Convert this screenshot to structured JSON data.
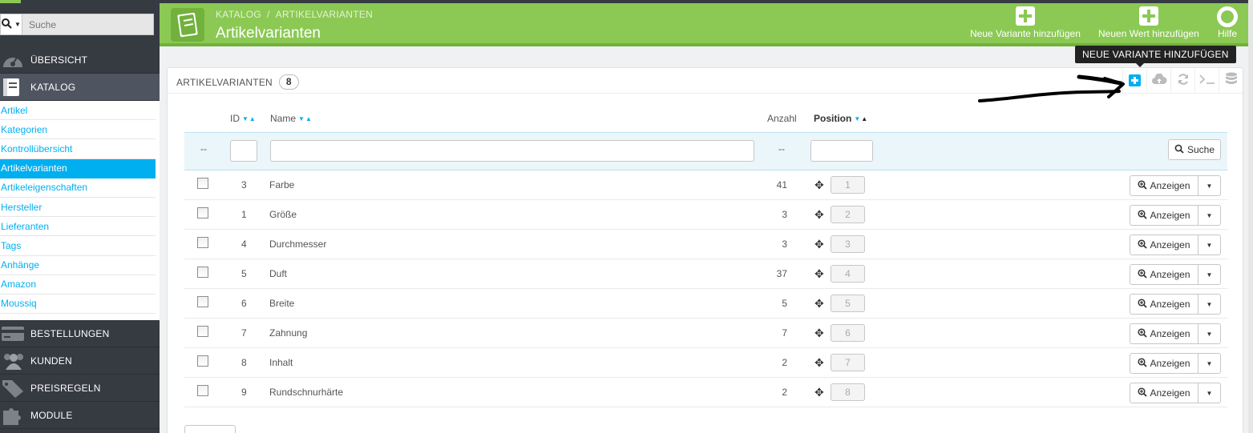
{
  "search": {
    "placeholder": "Suche"
  },
  "nav": {
    "overview": "ÜBERSICHT",
    "catalog": "KATALOG",
    "orders": "BESTELLUNGEN",
    "customers": "KUNDEN",
    "price_rules": "PREISREGELN",
    "modules": "MODULE"
  },
  "submenu": [
    "Artikel",
    "Kategorien",
    "Kontrollübersicht",
    "Artikelvarianten",
    "Artikeleigenschaften",
    "Hersteller",
    "Lieferanten",
    "Tags",
    "Anhänge",
    "Amazon",
    "Moussiq"
  ],
  "header": {
    "breadcrumb_1": "KATALOG",
    "breadcrumb_sep": "/",
    "breadcrumb_2": "ARTIKELVARIANTEN",
    "title": "Artikelvarianten",
    "btn_new_variant": "Neue Variante hinzufügen",
    "btn_new_value": "Neuen Wert hinzufügen",
    "btn_help": "Hilfe"
  },
  "tooltip": "NEUE VARIANTE HINZUFÜGEN",
  "panel": {
    "title": "ARTIKELVARIANTEN",
    "count": "8"
  },
  "table": {
    "headers": {
      "id": "ID",
      "name": "Name",
      "count": "Anzahl",
      "position": "Position"
    },
    "filter_dash": "--",
    "search_label": "Suche",
    "action_label": "Anzeigen",
    "rows": [
      {
        "id": "3",
        "name": "Farbe",
        "count": "41",
        "position": "1"
      },
      {
        "id": "1",
        "name": "Größe",
        "count": "3",
        "position": "2"
      },
      {
        "id": "4",
        "name": "Durchmesser",
        "count": "3",
        "position": "3"
      },
      {
        "id": "5",
        "name": "Duft",
        "count": "37",
        "position": "4"
      },
      {
        "id": "6",
        "name": "Breite",
        "count": "5",
        "position": "5"
      },
      {
        "id": "7",
        "name": "Zahnung",
        "count": "7",
        "position": "6"
      },
      {
        "id": "8",
        "name": "Inhalt",
        "count": "2",
        "position": "7"
      },
      {
        "id": "9",
        "name": "Rundschnurhärte",
        "count": "2",
        "position": "8"
      }
    ]
  },
  "colors": {
    "accent_green": "#8bc954",
    "accent_blue": "#00aff0",
    "sidebar": "#363a41"
  }
}
